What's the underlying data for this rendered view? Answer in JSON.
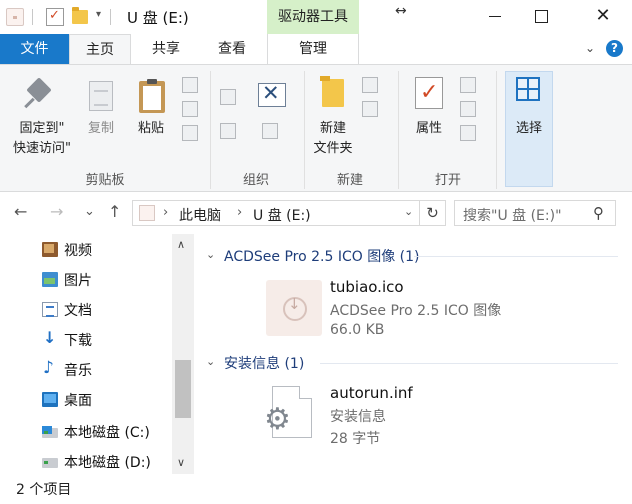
{
  "titlebar": {
    "title": "U 盘 (E:)",
    "context_tab": "驱动器工具",
    "quick_access_dropdown": "▾",
    "resize_arrow": "↔",
    "close_glyph": "✕"
  },
  "tabs": {
    "file": "文件",
    "home": "主页",
    "share": "共享",
    "view": "查看",
    "manage": "管理",
    "ribbon_toggle": "⌄",
    "help": "?"
  },
  "ribbon": {
    "pin_label_1": "固定到\"",
    "pin_label_2": "快速访问\"",
    "copy_label": "复制",
    "paste_label": "粘贴",
    "group_clipboard": "剪贴板",
    "group_organize": "组织",
    "new_folder_label_1": "新建",
    "new_folder_label_2": "文件夹",
    "group_new": "新建",
    "properties_label": "属性",
    "group_open": "打开",
    "select_label": "选择"
  },
  "address": {
    "back": "←",
    "forward": "→",
    "recent": "⌄",
    "up": "↑",
    "crumb_sep_1": "›",
    "crumb_1": "此电脑",
    "crumb_sep_2": "›",
    "crumb_2": "U 盘 (E:)",
    "dropdown": "⌄",
    "refresh": "↻",
    "search_placeholder": "搜索\"U 盘 (E:)\"",
    "search_icon": "⚲"
  },
  "sidebar": {
    "items": [
      {
        "label": "视频",
        "icon": "video-folder-icon"
      },
      {
        "label": "图片",
        "icon": "pictures-folder-icon"
      },
      {
        "label": "文档",
        "icon": "documents-folder-icon"
      },
      {
        "label": "下载",
        "icon": "downloads-folder-icon"
      },
      {
        "label": "音乐",
        "icon": "music-folder-icon"
      },
      {
        "label": "桌面",
        "icon": "desktop-folder-icon"
      },
      {
        "label": "本地磁盘 (C:)",
        "icon": "system-drive-icon"
      },
      {
        "label": "本地磁盘 (D:)",
        "icon": "local-drive-icon"
      }
    ],
    "scroll_up": "∧",
    "scroll_down": "∨"
  },
  "content": {
    "groups": [
      {
        "header": "ACDSee Pro 2.5 ICO 图像 (1)",
        "chevron": "⌄",
        "files": [
          {
            "name": "tubiao.ico",
            "type": "ACDSee Pro 2.5 ICO 图像",
            "size": "66.0 KB",
            "icon": "ico-image-icon",
            "arrow": "↓"
          }
        ]
      },
      {
        "header": "安装信息 (1)",
        "chevron": "⌄",
        "files": [
          {
            "name": "autorun.inf",
            "type": "安装信息",
            "size": "28 字节",
            "icon": "setup-info-file-icon",
            "gear": "⚙"
          }
        ]
      }
    ]
  },
  "status": {
    "item_count": "2 个项目"
  },
  "colors": {
    "accent": "#1979ca",
    "context_tab_bg": "#d6f0c9",
    "group_header": "#1e3d7a"
  }
}
